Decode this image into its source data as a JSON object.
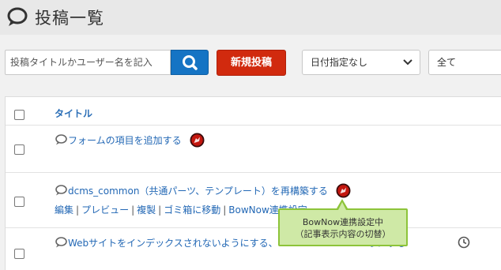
{
  "header": {
    "title": "投稿一覧",
    "icon": "speech-bubble-icon"
  },
  "toolbar": {
    "search_placeholder": "投稿タイトルかユーザー名を記入",
    "search_icon": "search-icon",
    "new_post_label": "新規投稿",
    "date_filter": {
      "selected": "日付指定なし"
    },
    "category_filter": {
      "selected": "全て"
    }
  },
  "table": {
    "column_title": "タイトル",
    "rows": [
      {
        "title": "フォームの項目を追加する",
        "badge": "bownow-icon"
      },
      {
        "title": "dcms_common（共通パーツ、テンプレート）を再構築する",
        "badge": "bownow-icon",
        "actions": [
          "編集",
          "プレビュー",
          "複製",
          "ゴミ箱に移動",
          "BowNow連携設定"
        ]
      },
      {
        "title": "Webサイトをインデックスされないようにする、　　　　　　　　　　うにする",
        "badge": "clock-icon"
      }
    ]
  },
  "tooltip": {
    "line1": "BowNow連携設定中",
    "line2": "（記事表示内容の切替）"
  },
  "colors": {
    "accent": "#1574c4",
    "danger": "#d12a0e",
    "link": "#2368b5",
    "tooltip_bg": "#cfe9a6",
    "tooltip_border": "#8dc43a"
  }
}
